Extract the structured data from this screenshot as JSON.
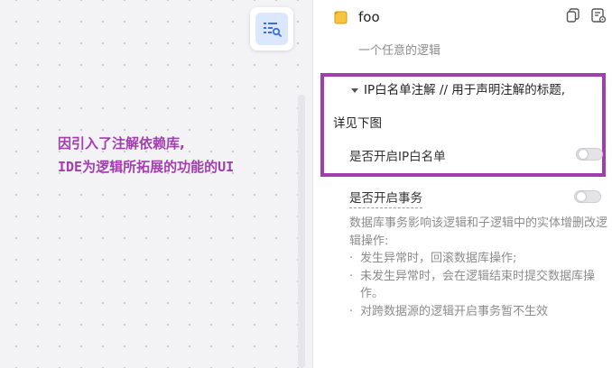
{
  "canvas": {
    "annotation_line1": "因引入了注解依赖库,",
    "annotation_line2": "IDE为逻辑所拓展的功能的UI",
    "tool_icon": "list-search-icon"
  },
  "panel": {
    "node_icon": "logic-node-icon",
    "title": "foo",
    "description": "一个任意的逻辑",
    "header_icons": [
      "copy-icon",
      "settings-doc-icon"
    ],
    "ip_section": {
      "title_line1": "IP白名单注解 // 用于声明注解的标题,",
      "title_line2": "详见下图",
      "toggle_label": "是否开启IP白名单",
      "toggle_on": false
    },
    "transaction": {
      "label": "是否开启事务",
      "toggle_on": false,
      "description": "数据库事务影响该逻辑和子逻辑中的实体增删改逻辑操作:",
      "bullets": [
        "发生异常时，回滚数据库操作;",
        "未发生异常时，会在逻辑结束时提交数据库操作。",
        "对跨数据源的逻辑开启事务暂不生效"
      ]
    }
  },
  "colors": {
    "annotation": "#a33cb0",
    "tool_button_bg": "#dbe7ff",
    "tool_icon": "#3a6fe0"
  }
}
